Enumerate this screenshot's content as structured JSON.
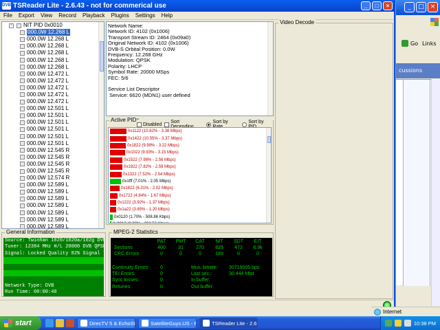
{
  "app": {
    "title": "TSReader Lite - 2.6.43 - not for commerical use",
    "icon_text": "DVB",
    "accent": "#0a4fd6"
  },
  "menu": [
    "File",
    "Export",
    "View",
    "Record",
    "Playback",
    "Plugins",
    "Settings",
    "Help"
  ],
  "tree": {
    "root_label": "NIT PID 0x0010",
    "items": [
      "000.0W 12.268 L",
      "000.0W 12.268 L",
      "000.0W 12.268 L",
      "000.0W 12.268 L",
      "000.0W 12.268 L",
      "000.0W 12.268 L",
      "000.0W 12.472 L",
      "000.0W 12.472 L",
      "000.0W 12.472 L",
      "000.0W 12.472 L",
      "000.0W 12.472 L",
      "000.0W 12.501 L",
      "000.0W 12.501 L",
      "000.0W 12.501 L",
      "000.0W 12.501 L",
      "000.0W 12.501 L",
      "000.0W 12.501 L",
      "000.0W 12.545 R",
      "000.0W 12.545 R",
      "000.0W 12.545 R",
      "000.0W 12.545 R",
      "000.0W 12.574 R",
      "000.0W 12.589 L",
      "000.0W 12.589 L",
      "000.0W 12.589 L",
      "000.0W 12.589 L",
      "000.0W 12.589 L",
      "000.0W 12.589 L",
      "000.0W 12.589 L",
      "000.0W 12.589 L"
    ]
  },
  "netinfo": {
    "lines": [
      "Network Name:",
      "Network ID: 4102 (0x1006)",
      "Transport Stream ID: 2464 (0x09a0)",
      "Original Network ID: 4102 (0x1006)",
      "DVB-S Orbital Position: 0.0W",
      "Frequency: 12.268 GHz",
      "Modulation: QPSK",
      "Polarity: LHCP",
      "Symbol Rate: 20000 MSps",
      "FEC: 5/6",
      "",
      "Service List Descriptor",
      " Service: 6620 (MDN1) user defined"
    ]
  },
  "video_decode": {
    "label": "Video Decode"
  },
  "active_pids": {
    "label": "Active PIDs",
    "options": {
      "disabled": "Disabled",
      "sort_desc": "Sort Decending",
      "sort_rate": "Sort by Rate",
      "sort_pid": "Sort by PID"
    },
    "rows": [
      {
        "text": "0x1122 (10.62% - 3.38 Mbps)",
        "pct": 10.62,
        "color": "#e00000"
      },
      {
        "text": "0x1422 (10.55% - 3.37 Mbps)",
        "pct": 10.55,
        "color": "#e00000"
      },
      {
        "text": "0x1822 (9.99% - 3.22 Mbps)",
        "pct": 9.99,
        "color": "#e00000"
      },
      {
        "text": "0x1022 (9.93% - 3.15 Mbps)",
        "pct": 9.93,
        "color": "#e00000"
      },
      {
        "text": "0x1522 (7.98% - 2.56 Mbps)",
        "pct": 7.98,
        "color": "#e00000"
      },
      {
        "text": "0x1922 (7.82% - 2.59 Mbps)",
        "pct": 7.82,
        "color": "#e00000"
      },
      {
        "text": "0x1322 (7.52% - 2.54 Mbps)",
        "pct": 7.52,
        "color": "#e00000"
      },
      {
        "text": "0x1fff (7.01% - 2.05 Mbps)",
        "pct": 7.01,
        "color": "#00c000"
      },
      {
        "text": "0x1822 (6.31% - 2.02 Mbps)",
        "pct": 6.31,
        "color": "#e00000"
      },
      {
        "text": "0x1722 (4.84% - 1.67 Mbps)",
        "pct": 4.84,
        "color": "#e00000"
      },
      {
        "text": "0x1222 (3.92% - 1.37 Mbps)",
        "pct": 3.92,
        "color": "#e00000"
      },
      {
        "text": "0x1a22 (3.85% - 1.20 Mbps)",
        "pct": 3.85,
        "color": "#e00000"
      },
      {
        "text": "0x0120 (1.70% - 508.86 Kbps)",
        "pct": 1.7,
        "color": "#00c000"
      },
      {
        "text": "0x0012 (0.90% - 268.56 Kbps)",
        "pct": 0.9,
        "color": "#00c000"
      },
      {
        "text": "0x1523 (0.54% - 163.25 Kbps)",
        "pct": 0.54,
        "color": "#e00000"
      },
      {
        "text": "0x1023 (0.54% - 163.22 Kbps)",
        "pct": 0.54,
        "color": "#e00000"
      }
    ]
  },
  "general": {
    "label": "General Information",
    "lines": [
      "Source: Twinhan 1020/1020a/102g DVB-S",
      "Tuner: 12384 MHz H/L 20000 DVB QPSK",
      "Signal: Locked Quality 82% Signal 70%",
      "",
      "",
      "",
      "",
      "Network Type: DVB",
      "Run Time: 00:00:40"
    ]
  },
  "mpeg": {
    "label": "MPEG-2 Statistics",
    "headers": [
      "",
      "PAT",
      "PMT",
      "CAT",
      "NIT",
      "SDT",
      "EIT"
    ],
    "rows": [
      [
        "Sections",
        "400",
        "31",
        "270",
        "825",
        "472",
        "6.9k"
      ],
      [
        "CRC Errors",
        "0",
        "0",
        "0",
        "189",
        "0",
        "0"
      ]
    ],
    "continuity_label": "Continuity Errors:",
    "continuity_value": "0",
    "mux_label": "Mux. bitrate:",
    "mux_value": "30719005 bps",
    "tei_label": "TEI Errors:",
    "tei_value": "0",
    "last_label": "Last sec.:",
    "last_value": "30.444 Mbit",
    "sync_label": "Sync losses:",
    "sync_value": "0",
    "inbuf_label": "In buffer:",
    "inbuf_value": "",
    "retunes_label": "Retunes:",
    "retunes_value": "0",
    "outbuf_label": "Out buffer:",
    "outbuf_value": ""
  },
  "ie": {
    "go": "Go",
    "links": "Links",
    "panel_text": "cussions",
    "status": "Internet"
  },
  "taskbar": {
    "start": "start",
    "tasks": [
      "DirecTV 5 & EchoStar ...",
      "SatelliteGuys.US - Po...",
      "TSReader Lite - 2.6...."
    ],
    "clock": "10:38 PM"
  }
}
